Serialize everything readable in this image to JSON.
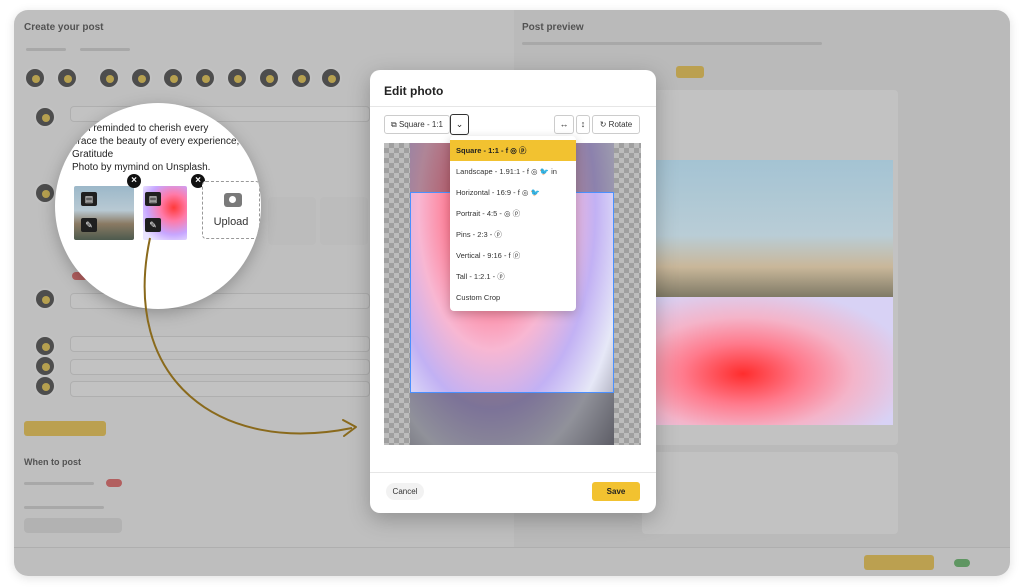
{
  "left_panel": {
    "title": "Create your post",
    "section_when": "When to post"
  },
  "right_panel": {
    "title": "Post preview"
  },
  "magnifier": {
    "caption_lines": [
      ", I'm reminded to cherish every",
      "brace the beauty of every experience,",
      "Gratitude",
      "Photo by mymind on Unsplash."
    ],
    "upload_label": "Upload"
  },
  "modal": {
    "title": "Edit photo",
    "aspect_button": "Square - 1:1",
    "rotate_label": "Rotate",
    "cancel_label": "Cancel",
    "save_label": "Save",
    "aspect_options": [
      {
        "label": "Square - 1:1 -",
        "icons": "f ◎ ⓟ"
      },
      {
        "label": "Landscape - 1.91:1 -",
        "icons": "f ◎ 🐦 in"
      },
      {
        "label": "Horizontal - 16:9 -",
        "icons": "f ◎ 🐦"
      },
      {
        "label": "Portrait - 4:5 -",
        "icons": "◎ ⓟ"
      },
      {
        "label": "Pins - 2:3 -",
        "icons": "ⓟ"
      },
      {
        "label": "Vertical - 9:16 -",
        "icons": "f ⓟ"
      },
      {
        "label": "Tall - 1:2.1 -",
        "icons": "ⓟ"
      },
      {
        "label": "Custom Crop",
        "icons": ""
      }
    ]
  },
  "colors": {
    "accent": "#f2c230",
    "toggle_red": "#e24b4b",
    "crop_blue": "#4a90ff"
  }
}
